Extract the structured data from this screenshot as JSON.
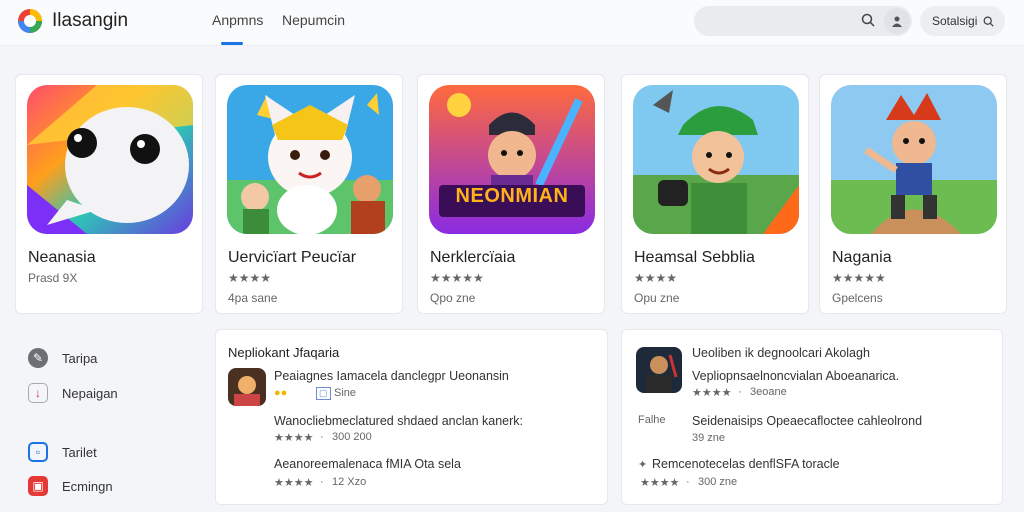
{
  "header": {
    "app_name": "Ilasangin",
    "tabs": [
      {
        "label": "Anpmns",
        "active": true
      },
      {
        "label": "Nepumcin",
        "active": false
      }
    ],
    "settings_label": "Sotalsigi"
  },
  "colors": {
    "accent": "#1a73e8",
    "star": "#f2b705"
  },
  "featured": [
    {
      "title": "Neanasia",
      "rating": "Prasd 9X",
      "price": ""
    },
    {
      "title": "Uervicïart Peucïar",
      "rating": "★★★★",
      "price": "4pa sane"
    },
    {
      "title": "Nerklercïaia",
      "rating": "★★★★★",
      "price": "Qpo zne"
    },
    {
      "title": "Heamsal Sebblia",
      "rating": "★★★★",
      "price": "Opu zne"
    },
    {
      "title": "Nagania",
      "rating": "★★★★★",
      "price": "Gpelcens"
    }
  ],
  "banner_text": "NEONMIAN",
  "sidebar": [
    {
      "label": "Taripa",
      "icon": "pin-icon"
    },
    {
      "label": "Nepaigan",
      "icon": "bookmark-icon"
    },
    {
      "label": "Tarilet",
      "icon": "chat-icon"
    },
    {
      "label": "Ecmingn",
      "icon": "calendar-icon"
    }
  ],
  "panel_left": {
    "title": "Nepliokant Jfaqaria",
    "rows": [
      {
        "text": "Peaiagnes Iamacela danclegpr Ueonansin",
        "meta1": "Sine"
      },
      {
        "text": "Wanocliebmeclatured shdaed anclan kanerk:",
        "stars": "★★★★",
        "meta": "300 200"
      },
      {
        "text": "Aeanoreemalenaca fMIA Ota sela",
        "stars": "★★★★",
        "meta": "12 Xzo"
      }
    ]
  },
  "panel_right": {
    "rows": [
      {
        "text": "Ueoliben ik degnoolcari Akolagh"
      },
      {
        "text": "Vepliopnsaelnoncvialan Aboeanarica.",
        "stars": "★★★★",
        "meta": "3eoane"
      },
      {
        "text": "Seidenaisips Opeaecafloctee cahleolrond",
        "left": "Falhe",
        "meta": "39 zne"
      },
      {
        "text": "Remcenotecelas denflSFA toracle",
        "stars": "★★★★",
        "meta": "300 zne"
      }
    ]
  }
}
